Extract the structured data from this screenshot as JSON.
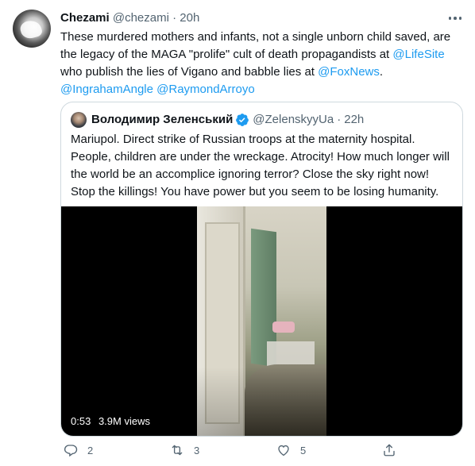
{
  "tweet": {
    "author_name": "Chezami",
    "author_handle": "@chezami",
    "separator": "·",
    "time": "20h",
    "text_lines": [
      {
        "before": "These murdered mothers and infants, not a single unborn child saved, are",
        "link": "",
        "after": ""
      },
      {
        "before": "the legacy of the MAGA \"prolife\" cult of death propagandists at ",
        "link": "@LifeSite",
        "after": ""
      },
      {
        "before": "who publish the lies of Vigano and babble lies at ",
        "link": "@FoxNews",
        "after": "."
      },
      {
        "before": "",
        "link": "@IngrahamAngle @RaymondArroyo",
        "after": ""
      }
    ]
  },
  "quote": {
    "author_name": "Володимир Зеленський",
    "author_handle": "@ZelenskyyUa",
    "separator": "·",
    "time": "22h",
    "text": "Mariupol. Direct strike of Russian troops at the maternity hospital. People, children are under the wreckage. Atrocity! How much longer will the world be an accomplice ignoring terror? Close the sky right now! Stop the killings! You have power but you seem to be losing humanity.",
    "video_duration": "0:53",
    "video_views": "3.9M views"
  },
  "actions": {
    "reply_count": "2",
    "retweet_count": "3",
    "like_count": "5"
  },
  "colors": {
    "link": "#1d9bf0",
    "secondary_text": "#536471",
    "border": "#cfd9de"
  }
}
